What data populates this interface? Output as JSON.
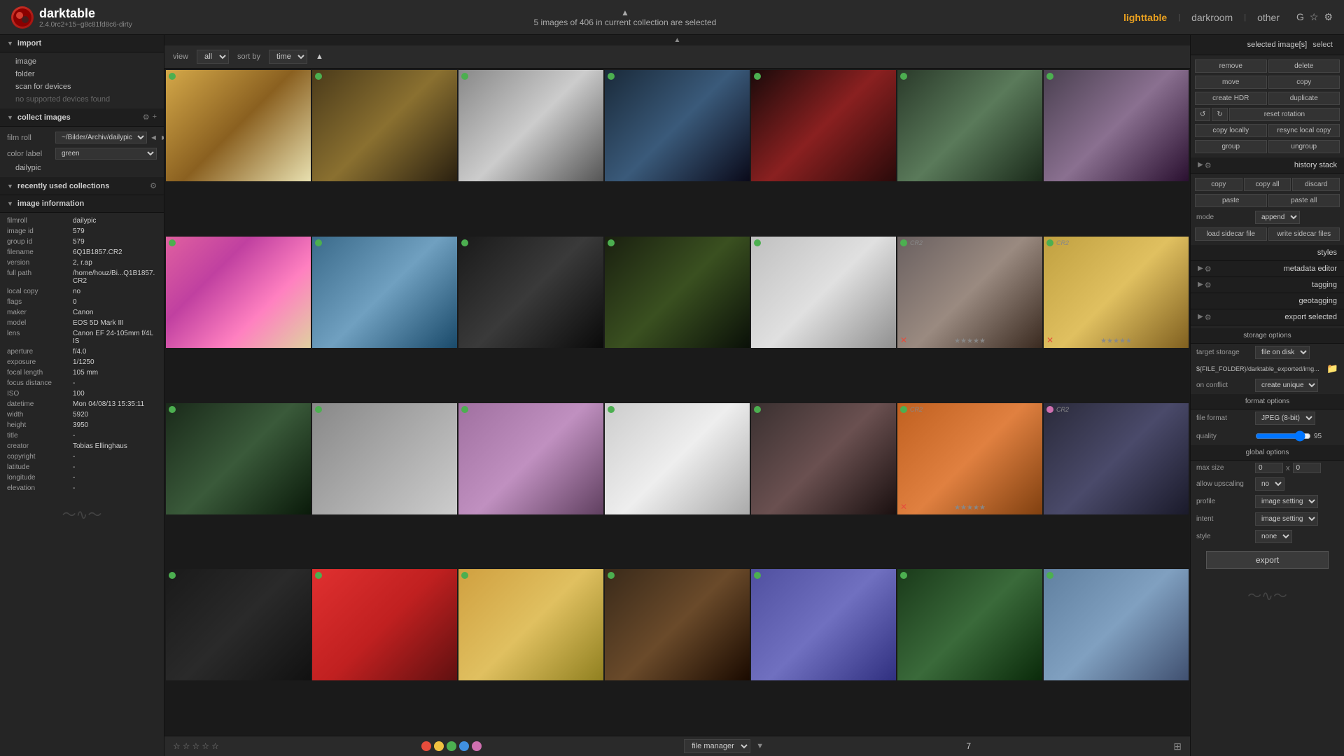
{
  "app": {
    "name": "darktable",
    "version": "2.4.0rc2+15~g8c81fd8c6-dirty",
    "logo_text": "dt"
  },
  "header": {
    "selection_info": "5 images of 406 in current collection are selected",
    "view_tabs": [
      "lighttable",
      "darkroom",
      "other"
    ],
    "active_tab": "lighttable",
    "select_label": "select"
  },
  "toolbar": {
    "view_label": "view",
    "view_value": "all",
    "sort_label": "sort by",
    "sort_value": "time"
  },
  "left_panel": {
    "import_section": "import",
    "import_items": [
      "image",
      "folder",
      "scan for devices",
      "no supported devices found"
    ],
    "collect_section": "collect images",
    "film_roll_label": "film roll",
    "film_roll_value": "~/Bilder/Archiv/dailypic",
    "color_label_label": "color label",
    "color_label_value": "green",
    "collection_label": "dailypic",
    "recently_used_section": "recently used collections",
    "image_info_section": "image information",
    "image_info": {
      "filmroll": "dailypic",
      "image_id": "579",
      "group_id": "579",
      "filename": "6Q1B1857.CR2",
      "version": "2, r.ap",
      "full_path": "/home/houz/Bi...Q1B1857.CR2",
      "local_copy": "no",
      "flags": "0",
      "maker": "Canon",
      "model": "EOS 5D Mark III",
      "lens": "Canon EF 24-105mm f/4L IS",
      "aperture": "f/4.0",
      "exposure": "1/1250",
      "focal_length": "105 mm",
      "focus_distance": "-",
      "iso": "100",
      "datetime": "Mon 04/08/13 15:35:11",
      "width": "5920",
      "height": "3950",
      "title": "-",
      "creator": "Tobias Ellinghaus",
      "copyright": "-",
      "latitude": "-",
      "longitude": "-",
      "elevation": "-"
    }
  },
  "right_panel": {
    "selected_label": "selected image[s]",
    "select_btn": "select",
    "buttons": {
      "remove": "remove",
      "delete": "delete",
      "move": "move",
      "copy": "copy",
      "create_hdr": "create HDR",
      "duplicate": "duplicate",
      "rotate_ccw": "↺",
      "rotate_cw": "↻",
      "reset_rotation": "reset rotation",
      "copy_locally": "copy locally",
      "resync_local_copy": "resync local copy",
      "group": "group",
      "ungroup": "ungroup"
    },
    "history_section": "history stack",
    "history_buttons": {
      "copy": "copy",
      "copy_all": "copy all",
      "discard": "discard",
      "paste": "paste",
      "paste_all": "paste all",
      "mode_label": "mode",
      "mode_value": "append",
      "load_sidecar": "load sidecar file",
      "write_sidecar": "write sidecar files"
    },
    "styles_section": "styles",
    "metadata_section": "metadata editor",
    "tagging_section": "tagging",
    "geotagging_section": "geotagging",
    "export_section": "export selected",
    "storage_options": "storage options",
    "target_storage_label": "target storage",
    "target_storage_value": "file on disk",
    "path_value": "${FILE_FOLDER}/darktable_exported/img...",
    "on_conflict_label": "on conflict",
    "on_conflict_value": "create unique filename",
    "format_options": "format options",
    "file_format_label": "file format",
    "file_format_value": "JPEG (8-bit)",
    "quality_label": "quality",
    "quality_value": "95",
    "global_options": "global options",
    "max_size_label": "max size",
    "max_size_w": "0",
    "max_size_h": "0",
    "allow_upscaling_label": "allow upscaling",
    "allow_upscaling_value": "no",
    "profile_label": "profile",
    "profile_value": "image settings",
    "intent_label": "intent",
    "intent_value": "image settings",
    "style_label": "style",
    "style_value": "none",
    "export_btn": "export"
  },
  "bottom_bar": {
    "page_number": "7",
    "view_mode": "file manager"
  },
  "thumbnails": [
    {
      "id": 1,
      "bg": "thumb-bg-1",
      "dot": "green",
      "cr2": false,
      "selected": false
    },
    {
      "id": 2,
      "bg": "thumb-bg-2",
      "dot": "green",
      "cr2": false,
      "selected": false
    },
    {
      "id": 3,
      "bg": "thumb-bg-3",
      "dot": "green",
      "cr2": false,
      "selected": false
    },
    {
      "id": 4,
      "bg": "thumb-bg-4",
      "dot": "green",
      "cr2": false,
      "selected": false
    },
    {
      "id": 5,
      "bg": "thumb-bg-5",
      "dot": "green",
      "cr2": false,
      "selected": false
    },
    {
      "id": 6,
      "bg": "thumb-bg-6",
      "dot": "green",
      "cr2": false,
      "selected": false
    },
    {
      "id": 7,
      "bg": "thumb-bg-7",
      "dot": "green",
      "cr2": false,
      "selected": false
    },
    {
      "id": 8,
      "bg": "thumb-bg-8",
      "dot": "green",
      "cr2": false,
      "selected": false
    },
    {
      "id": 9,
      "bg": "thumb-bg-9",
      "dot": "green",
      "cr2": false,
      "selected": false
    },
    {
      "id": 10,
      "bg": "thumb-bg-10",
      "dot": "green",
      "cr2": false,
      "selected": false
    },
    {
      "id": 11,
      "bg": "thumb-bg-11",
      "dot": "green",
      "cr2": false,
      "selected": false
    },
    {
      "id": 12,
      "bg": "thumb-bg-12",
      "dot": "green",
      "cr2": false,
      "selected": false
    },
    {
      "id": 13,
      "bg": "thumb-bg-13",
      "dot": "green",
      "cr2": true,
      "selected": false,
      "reject": true
    },
    {
      "id": 14,
      "bg": "thumb-bg-14",
      "dot": "green",
      "cr2": true,
      "selected": false,
      "reject": true
    },
    {
      "id": 15,
      "bg": "thumb-bg-15",
      "dot": "green",
      "cr2": false,
      "selected": false
    },
    {
      "id": 16,
      "bg": "thumb-bg-16",
      "dot": "green",
      "cr2": false,
      "selected": false
    },
    {
      "id": 17,
      "bg": "thumb-bg-17",
      "dot": "green",
      "cr2": false,
      "selected": false
    },
    {
      "id": 18,
      "bg": "thumb-bg-18",
      "dot": "green",
      "cr2": false,
      "selected": false
    },
    {
      "id": 19,
      "bg": "thumb-bg-19",
      "dot": "green",
      "cr2": false,
      "selected": false
    },
    {
      "id": 20,
      "bg": "thumb-bg-20",
      "dot": "green",
      "cr2": true,
      "selected": false,
      "reject": true
    },
    {
      "id": 21,
      "bg": "thumb-bg-21",
      "dot": "pink",
      "cr2": true,
      "selected": false
    },
    {
      "id": 22,
      "bg": "thumb-bg-22",
      "dot": "green",
      "cr2": false,
      "selected": false
    },
    {
      "id": 23,
      "bg": "thumb-bg-23",
      "dot": "green",
      "cr2": false,
      "selected": false
    },
    {
      "id": 24,
      "bg": "thumb-bg-24",
      "dot": "green",
      "cr2": false,
      "selected": false
    },
    {
      "id": 25,
      "bg": "thumb-bg-25",
      "dot": "green",
      "cr2": false,
      "selected": false
    },
    {
      "id": 26,
      "bg": "thumb-bg-26",
      "dot": "green",
      "cr2": false,
      "selected": false
    },
    {
      "id": 27,
      "bg": "thumb-bg-27",
      "dot": "green",
      "cr2": false,
      "selected": false
    },
    {
      "id": 28,
      "bg": "thumb-bg-28",
      "dot": "green",
      "cr2": false,
      "selected": false
    }
  ]
}
